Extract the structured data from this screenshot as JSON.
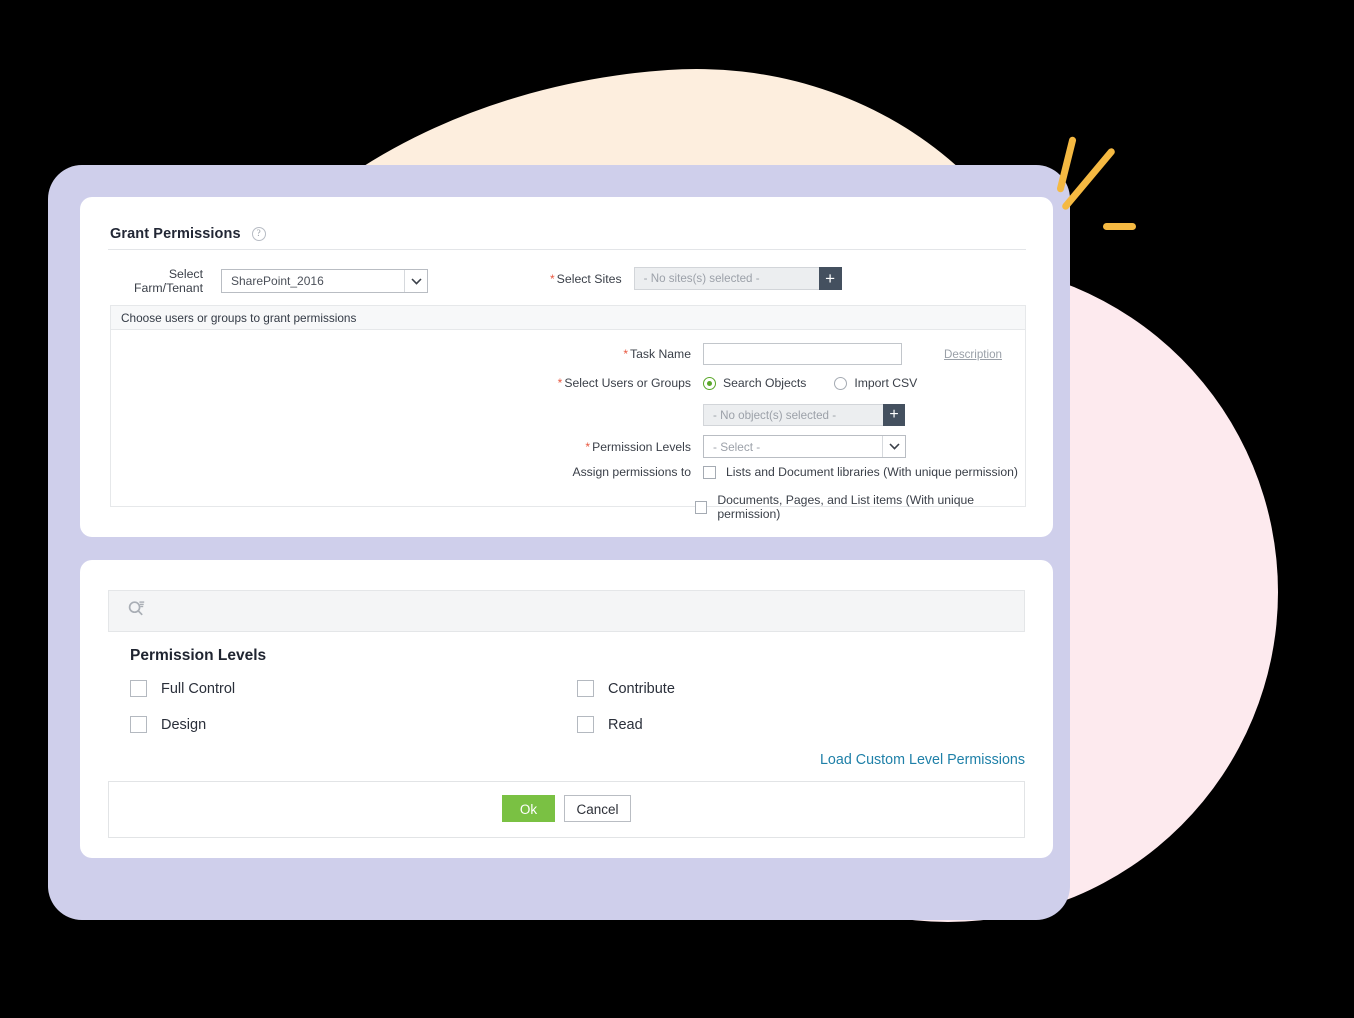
{
  "decor": {
    "peach_blob_color": "#fdeede",
    "pink_circle_color": "#fdeaee",
    "card_backing_color": "#cfcfeb",
    "sparkle_color": "#f5b942"
  },
  "grant_panel": {
    "title": "Grant Permissions",
    "help_icon": "help-circle-icon",
    "farm": {
      "label": "Select Farm/Tenant",
      "value": "SharePoint_2016",
      "caret_icon": "chevron-down-icon"
    },
    "sites": {
      "label": "Select Sites",
      "required": "*",
      "value": "- No sites(s) selected -",
      "add_label": "+"
    },
    "section_header": "Choose users or groups to grant permissions",
    "task_name": {
      "label": "Task Name",
      "required": "*",
      "value": "",
      "description_link": "Description"
    },
    "users_or_groups": {
      "label": "Select Users or Groups",
      "required": "*",
      "options": [
        {
          "label": "Search Objects",
          "selected": true
        },
        {
          "label": "Import CSV",
          "selected": false
        }
      ],
      "objects_value": "- No object(s) selected -",
      "add_label": "+"
    },
    "permission_levels": {
      "label": "Permission Levels",
      "required": "*",
      "value": "- Select -",
      "caret_icon": "chevron-down-icon"
    },
    "assign_to": {
      "label": "Assign permissions to",
      "options": [
        {
          "label": "Lists and Document libraries (With unique permission)",
          "checked": false
        },
        {
          "label": "Documents, Pages, and List items (With unique permission)",
          "checked": false
        }
      ]
    }
  },
  "levels_panel": {
    "search_icon": "search-filter-icon",
    "title": "Permission Levels",
    "items": [
      {
        "label": "Full Control",
        "checked": false
      },
      {
        "label": "Contribute",
        "checked": false
      },
      {
        "label": "Design",
        "checked": false
      },
      {
        "label": "Read",
        "checked": false
      }
    ],
    "load_link": "Load Custom Level Permissions",
    "link_color": "#1f80a8",
    "ok_label": "Ok",
    "ok_color": "#7ac143",
    "cancel_label": "Cancel"
  }
}
